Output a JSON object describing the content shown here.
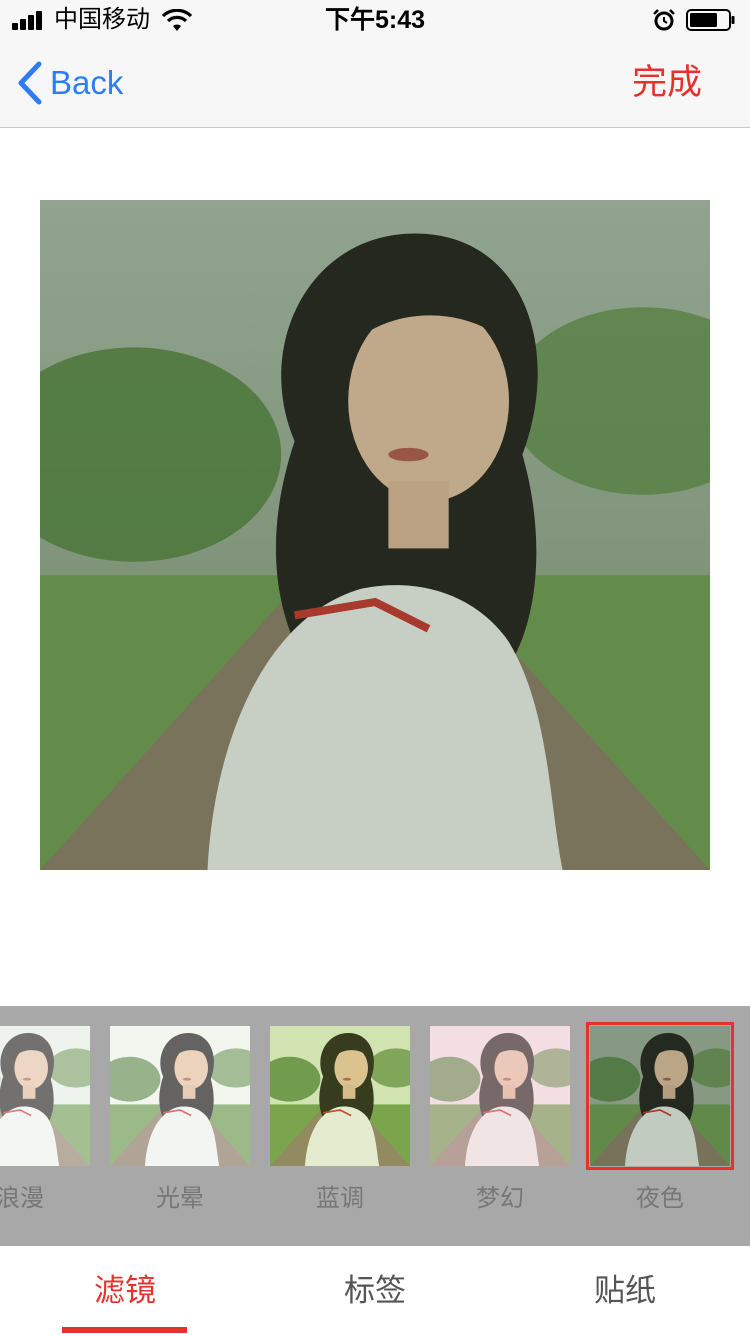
{
  "status_bar": {
    "carrier": "中国移动",
    "time": "下午5:43",
    "icons": [
      "signal-icon",
      "wifi-icon",
      "alarm-icon",
      "battery-icon"
    ]
  },
  "nav": {
    "back_label": "Back",
    "done_label": "完成"
  },
  "photo": {
    "description_icon": "portrait-photo"
  },
  "filters": {
    "items": [
      {
        "label": "浪漫"
      },
      {
        "label": "光晕"
      },
      {
        "label": "蓝调"
      },
      {
        "label": "梦幻"
      },
      {
        "label": "夜色"
      }
    ],
    "selected": "夜色"
  },
  "tabs": {
    "items": [
      {
        "label": "滤镜"
      },
      {
        "label": "标签"
      },
      {
        "label": "贴纸"
      }
    ],
    "active": "滤镜"
  },
  "colors": {
    "accent": "#e5322d",
    "link": "#2f7df6",
    "strip_bg": "#a8a8a8"
  }
}
